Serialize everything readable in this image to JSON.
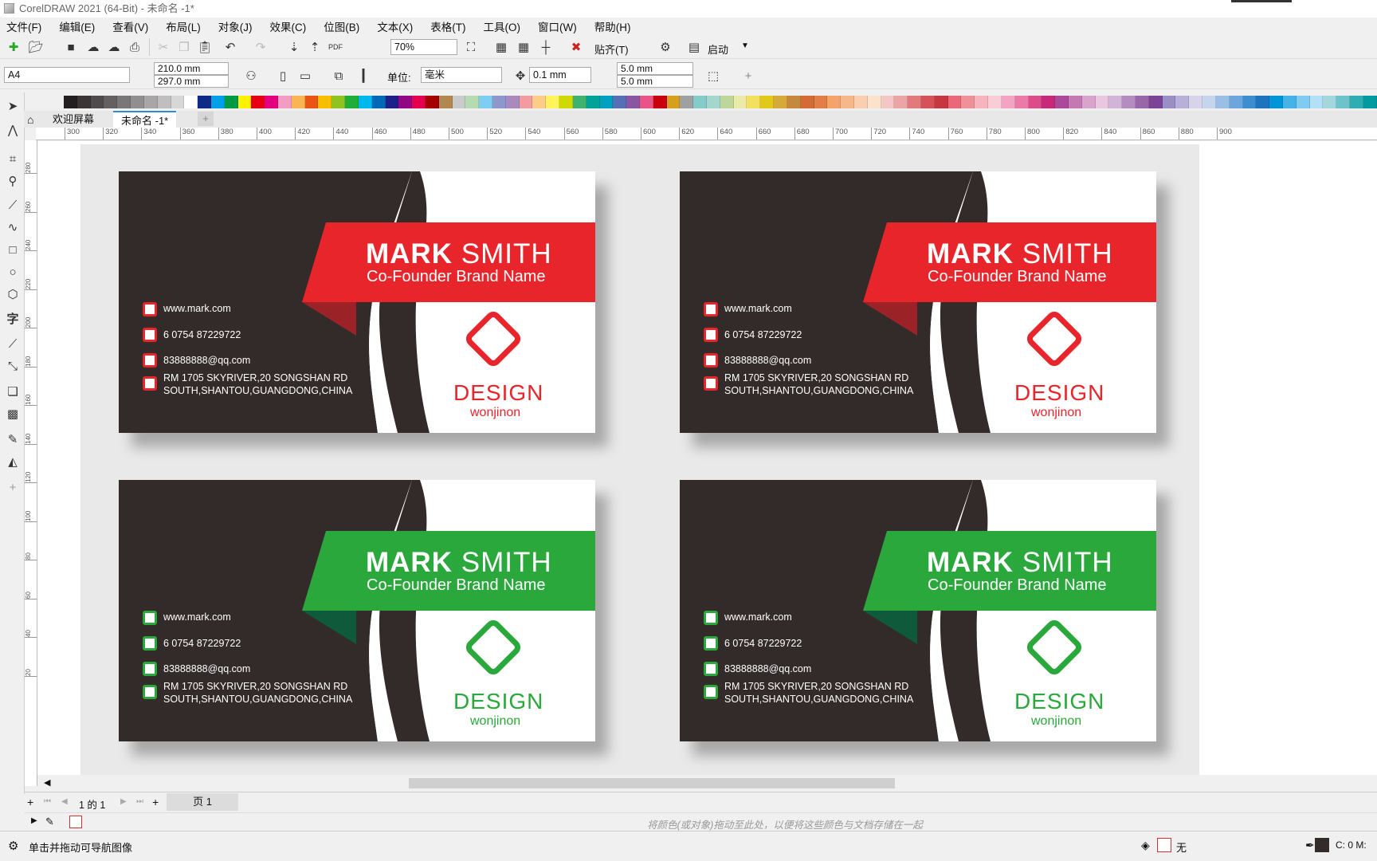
{
  "window": {
    "title": "CorelDRAW 2021 (64-Bit) - 未命名 -1*"
  },
  "menu": [
    "文件(F)",
    "编辑(E)",
    "查看(V)",
    "布局(L)",
    "对象(J)",
    "效果(C)",
    "位图(B)",
    "文本(X)",
    "表格(T)",
    "工具(O)",
    "窗口(W)",
    "帮助(H)"
  ],
  "toolbar1": {
    "zoom": "70%",
    "snap_label": "贴齐(T)",
    "launch_label": "启动"
  },
  "toolbar2": {
    "page_size": "A4",
    "width": "210.0 mm",
    "height": "297.0 mm",
    "units_label": "单位:",
    "units_value": "毫米",
    "nudge": "0.1 mm",
    "dup_x": "5.0 mm",
    "dup_y": "5.0 mm"
  },
  "tabs": {
    "welcome": "欢迎屏幕",
    "document": "未命名 -1*"
  },
  "ruler_h": [
    "300",
    "320",
    "340",
    "360",
    "380",
    "400",
    "420",
    "440",
    "460",
    "480",
    "500",
    "520",
    "540",
    "560",
    "580",
    "600",
    "620",
    "640",
    "660",
    "680",
    "700",
    "720",
    "740",
    "760",
    "780",
    "800",
    "820",
    "840",
    "860",
    "880",
    "900"
  ],
  "ruler_v": [
    "280",
    "260",
    "240",
    "220",
    "200",
    "180",
    "160",
    "140",
    "120",
    "100",
    "80",
    "60",
    "40",
    "20"
  ],
  "cards": [
    {
      "accent": "#e8252b",
      "shade": "#9b2227"
    },
    {
      "accent": "#e8252b",
      "shade": "#9b2227"
    },
    {
      "accent": "#2aa83b",
      "shade": "#0e5a3b"
    },
    {
      "accent": "#2aa83b",
      "shade": "#0e5a3b"
    }
  ],
  "card_text": {
    "first_name": "MARK",
    "last_name": "SMITH",
    "role": "Co-Founder Brand Name",
    "website": "www.mark.com",
    "phone": "6 0754 87229722",
    "email": "83888888@qq.com",
    "address1": "RM 1705 SKYRIVER,20 SONGSHAN RD",
    "address2": "SOUTH,SHANTOU,GUANGDONG,CHINA",
    "brand": "DESIGN",
    "brand_sub": "wonjinon"
  },
  "pagebar": {
    "page_count": "1 的 1",
    "page_tab": "页 1"
  },
  "docpalette": {
    "hint": "将颜色(或对象)拖动至此处，以便将这些颜色与文档存储在一起"
  },
  "status": {
    "message": "单击并拖动可导航图像",
    "fill_label": "无",
    "outline_label": "C: 0 M:"
  },
  "colors": {
    "card_dark": "#332a2a"
  }
}
